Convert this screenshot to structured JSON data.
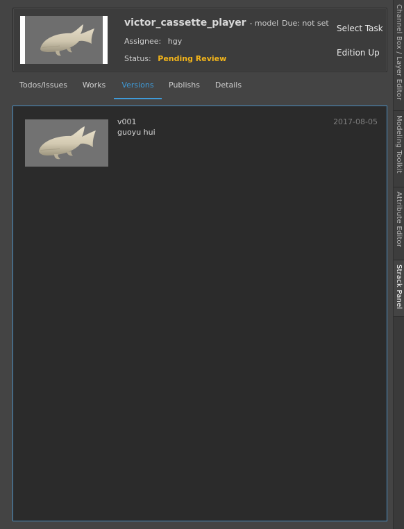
{
  "task": {
    "name": "victor_cassette_player",
    "step": "- model",
    "due_label": "Due:",
    "due_value": "not set",
    "assignee_label": "Assignee:",
    "assignee_value": "hgy",
    "status_label": "Status:",
    "status_value": "Pending Review",
    "thumbnail_icon": "fish-model-thumbnail"
  },
  "actions": {
    "select_task": "Select Task",
    "edition_up": "Edition Up"
  },
  "tabs": [
    {
      "label": "Todos/Issues",
      "active": false
    },
    {
      "label": "Works",
      "active": false
    },
    {
      "label": "Versions",
      "active": true
    },
    {
      "label": "Publishs",
      "active": false
    },
    {
      "label": "Details",
      "active": false
    }
  ],
  "versions": [
    {
      "name": "v001",
      "user": "guoyu hui",
      "date": "2017-08-05",
      "thumbnail_icon": "fish-model-thumbnail"
    }
  ],
  "dock_tabs": [
    {
      "label": "Channel Box / Layer Editor",
      "active": false
    },
    {
      "label": "Modeling Toolkit",
      "active": false
    },
    {
      "label": "Attribute Editor",
      "active": false
    },
    {
      "label": "Strack Panel",
      "active": true
    }
  ],
  "colors": {
    "status_pending": "#f3b51a",
    "tab_active": "#3f9bd9",
    "panel_border": "#4a8fc2"
  }
}
